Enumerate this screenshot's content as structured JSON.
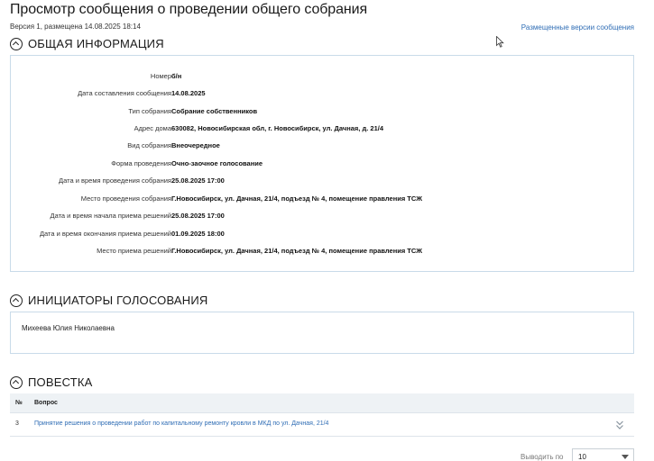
{
  "header": {
    "title": "Просмотр сообщения о проведении общего собрания",
    "subtitle": "Версия 1, размещена 14.08.2025 18:14",
    "versions_link": "Размещенные версии сообщения"
  },
  "general_info": {
    "title": "ОБЩАЯ ИНФОРМАЦИЯ",
    "rows": [
      {
        "label": "Номер",
        "value": "б/н"
      },
      {
        "label": "Дата составления сообщения",
        "value": "14.08.2025"
      },
      {
        "label": "Тип собрания",
        "value": "Собрание собственников"
      },
      {
        "label": "Адрес дома",
        "value": "630082, Новосибирская обл, г. Новосибирск, ул. Дачная, д. 21/4"
      },
      {
        "label": "Вид собрания",
        "value": "Внеочередное"
      },
      {
        "label": "Форма проведения",
        "value": "Очно-заочное голосование"
      },
      {
        "label": "Дата и время проведения собрания",
        "value": "25.08.2025 17:00"
      },
      {
        "label": "Место проведения собрания",
        "value": "Г.Новосибирск, ул. Дачная, 21/4, подъезд № 4, помещение правления ТСЖ"
      },
      {
        "label": "Дата и время начала приема решений",
        "value": "25.08.2025 17:00"
      },
      {
        "label": "Дата и время окончания приема решений",
        "value": "01.09.2025 18:00"
      },
      {
        "label": "Место приема решений",
        "value": "Г.Новосибирск, ул. Дачная, 21/4, подъезд № 4, помещение правления ТСЖ"
      }
    ]
  },
  "initiators": {
    "title": "ИНИЦИАТОРЫ ГОЛОСОВАНИЯ",
    "names": [
      "Михеева Юлия Николаевна"
    ]
  },
  "agenda": {
    "title": "ПОВЕСТКА",
    "columns": {
      "num": "№",
      "question": "Вопрос"
    },
    "rows": [
      {
        "num": "3",
        "question": "Принятие решения о проведении работ по капитальному ремонту кровли в МКД по ул. Дачная, 21/4"
      }
    ]
  },
  "pager": {
    "label": "Выводить по",
    "per_page": "10"
  },
  "colors": {
    "link": "#2f6db5",
    "panel_border": "#c9dbe9",
    "table_header_bg": "#eef2f5"
  }
}
